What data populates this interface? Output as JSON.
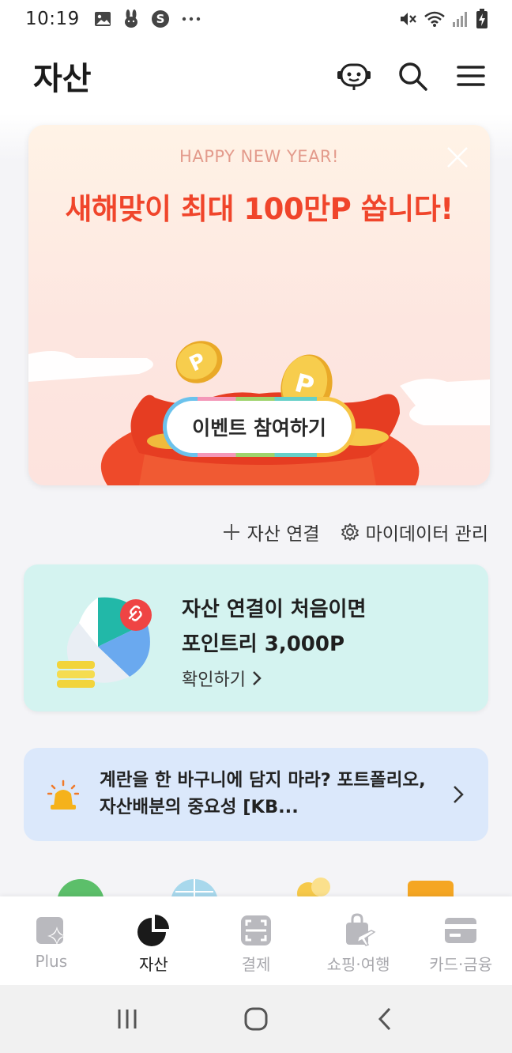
{
  "status_bar": {
    "time": "10:19",
    "icons_left": [
      "image-icon",
      "rabbit-icon",
      "s-app-icon",
      "more-dots-icon"
    ],
    "icons_right": [
      "mute-icon",
      "wifi-icon",
      "signal-icon",
      "battery-charging-icon"
    ]
  },
  "header": {
    "title": "자산",
    "actions": [
      "chatbot-icon",
      "search-icon",
      "menu-icon"
    ]
  },
  "banner": {
    "subtitle": "HAPPY NEW YEAR!",
    "headline": "새해맞이 최대 100만P 쏩니다!",
    "cta_label": "이벤트 참여하기",
    "headline_color": "#f0452b"
  },
  "links": {
    "connect_label": "자산 연결",
    "mydata_label": "마이데이터 관리"
  },
  "promo": {
    "line1": "자산 연결이 처음이면",
    "line2": "포인트리 3,000P",
    "more_label": "확인하기",
    "bg_color": "#d4f3f0"
  },
  "article": {
    "text": "계란을 한 바구니에 담지 마라? 포트폴리오, 자산배분의 중요성 [KB...",
    "bg_color": "#dbe8fb"
  },
  "bottom_nav": {
    "tabs": [
      {
        "label": "Plus",
        "icon": "plus-sparkle-icon",
        "active": false
      },
      {
        "label": "자산",
        "icon": "pie-chart-icon",
        "active": true
      },
      {
        "label": "결제",
        "icon": "scan-pay-icon",
        "active": false
      },
      {
        "label": "쇼핑·여행",
        "icon": "shopping-travel-icon",
        "active": false
      },
      {
        "label": "카드·금융",
        "icon": "card-icon",
        "active": false
      }
    ]
  },
  "system_nav": [
    "recent-apps-icon",
    "home-icon",
    "back-icon"
  ]
}
